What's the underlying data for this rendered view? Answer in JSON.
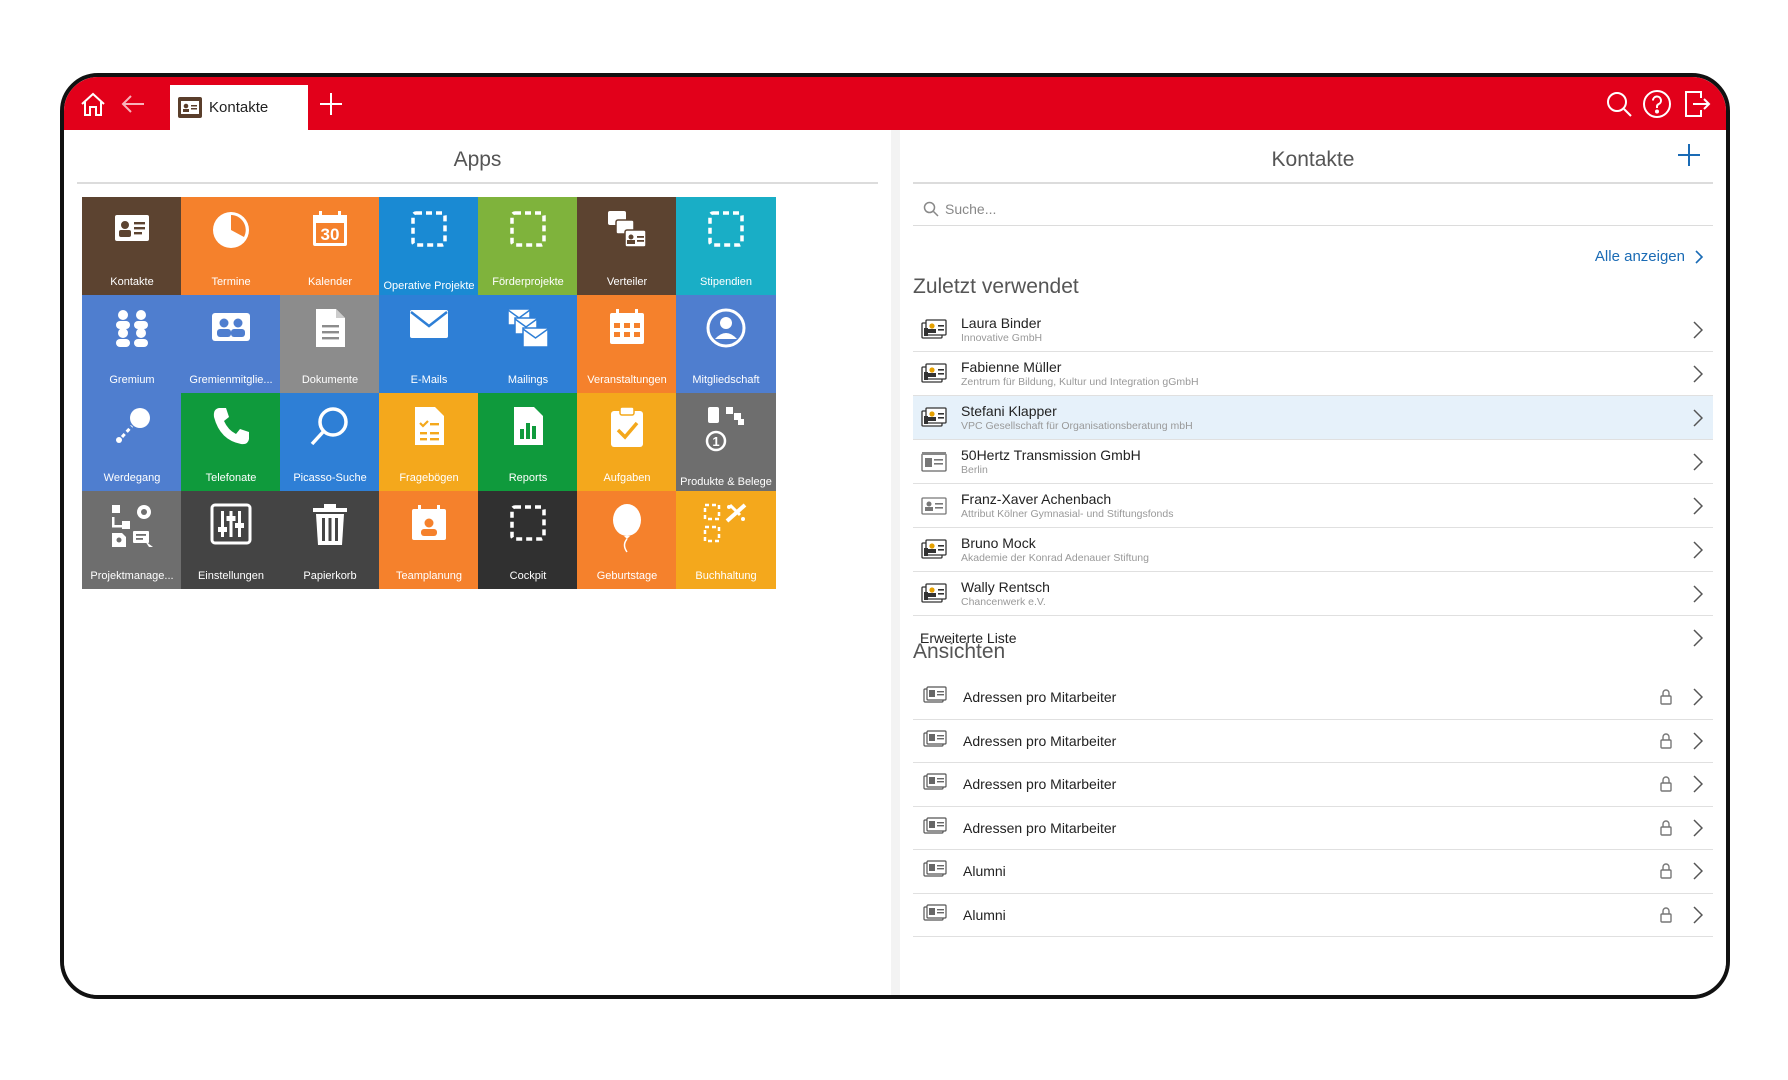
{
  "topbar": {
    "tab_label": "Kontakte",
    "accent": "#e2001a"
  },
  "apps_panel": {
    "title": "Apps",
    "tiles": [
      {
        "label": "Kontakte",
        "color": "#5c4330",
        "icon": "contact-card-icon"
      },
      {
        "label": "Termine",
        "color": "#f5812c",
        "icon": "pie-clock-icon"
      },
      {
        "label": "Kalender",
        "color": "#f5812c",
        "icon": "calendar-30-icon"
      },
      {
        "label": "Operative Projekte",
        "color": "#1a8ad3",
        "icon": "dashed-square-icon"
      },
      {
        "label": "Förderprojekte",
        "color": "#7fb33c",
        "icon": "dashed-square-icon"
      },
      {
        "label": "Verteiler",
        "color": "#5c4330",
        "icon": "distribution-cards-icon"
      },
      {
        "label": "Stipendien",
        "color": "#19aec6",
        "icon": "dashed-square-icon"
      },
      {
        "label": "Gremium",
        "color": "#4f7ecf",
        "icon": "group-icon"
      },
      {
        "label": "Gremienmitglie...",
        "color": "#4f7ecf",
        "icon": "member-card-icon"
      },
      {
        "label": "Dokumente",
        "color": "#8c8c8c",
        "icon": "document-icon"
      },
      {
        "label": "E-Mails",
        "color": "#2e7fd6",
        "icon": "envelope-icon"
      },
      {
        "label": "Mailings",
        "color": "#2e7fd6",
        "icon": "multi-envelope-icon"
      },
      {
        "label": "Veranstaltungen",
        "color": "#f5812c",
        "icon": "event-calendar-icon"
      },
      {
        "label": "Mitgliedschaft",
        "color": "#4f7ecf",
        "icon": "person-circle-icon"
      },
      {
        "label": "Werdegang",
        "color": "#4f7ecf",
        "icon": "career-path-icon"
      },
      {
        "label": "Telefonate",
        "color": "#0f9a3c",
        "icon": "phone-icon"
      },
      {
        "label": "Picasso-Suche",
        "color": "#2e7fd6",
        "icon": "magnifier-icon"
      },
      {
        "label": "Fragebögen",
        "color": "#f4a81c",
        "icon": "questionnaire-icon"
      },
      {
        "label": "Reports",
        "color": "#0f9a3c",
        "icon": "report-chart-icon"
      },
      {
        "label": "Aufgaben",
        "color": "#f4a81c",
        "icon": "clipboard-check-icon"
      },
      {
        "label": "Produkte & Belege",
        "color": "#6e6e6e",
        "icon": "products-icon"
      },
      {
        "label": "Projektmanage...",
        "color": "#6e6e6e",
        "icon": "project-gear-icon"
      },
      {
        "label": "Einstellungen",
        "color": "#444444",
        "icon": "sliders-icon"
      },
      {
        "label": "Papierkorb",
        "color": "#444444",
        "icon": "trash-icon"
      },
      {
        "label": "Teamplanung",
        "color": "#f5812c",
        "icon": "team-calendar-icon"
      },
      {
        "label": "Cockpit",
        "color": "#303030",
        "icon": "dashed-square-icon"
      },
      {
        "label": "Geburtstage",
        "color": "#f5812c",
        "icon": "balloon-icon"
      },
      {
        "label": "Buchhaltung",
        "color": "#f4a81c",
        "icon": "accounting-icon"
      }
    ]
  },
  "contacts_panel": {
    "title": "Kontakte",
    "search_placeholder": "Suche...",
    "show_all": "Alle anzeigen",
    "recent_title": "Zuletzt verwendet",
    "recent": [
      {
        "name": "Laura Binder",
        "sub": "Innovative GmbH",
        "icon": "person-card-icon"
      },
      {
        "name": "Fabienne Müller",
        "sub": "Zentrum für Bildung, Kultur und Integration gGmbH",
        "icon": "person-card-icon"
      },
      {
        "name": "Stefani Klapper",
        "sub": "VPC Gesellschaft für Organisationsberatung mbH",
        "icon": "person-card-icon",
        "highlighted": true
      },
      {
        "name": "50Hertz Transmission GmbH",
        "sub": "Berlin",
        "icon": "company-card-icon"
      },
      {
        "name": "Franz-Xaver Achenbach",
        "sub": "Attribut Kölner Gymnasial- und Stiftungsfonds",
        "icon": "person-card-grey-icon"
      },
      {
        "name": "Bruno Mock",
        "sub": "Akademie der Konrad Adenauer Stiftung",
        "icon": "person-card-icon"
      },
      {
        "name": "Wally Rentsch",
        "sub": "Chancenwerk e.V.",
        "icon": "person-card-icon"
      }
    ],
    "extended_list": "Erweiterte Liste",
    "views_title": "Ansichten",
    "views": [
      {
        "name": "Adressen pro Mitarbeiter"
      },
      {
        "name": "Adressen pro Mitarbeiter"
      },
      {
        "name": "Adressen pro Mitarbeiter"
      },
      {
        "name": "Adressen pro Mitarbeiter"
      },
      {
        "name": "Alumni"
      },
      {
        "name": "Alumni"
      }
    ]
  }
}
